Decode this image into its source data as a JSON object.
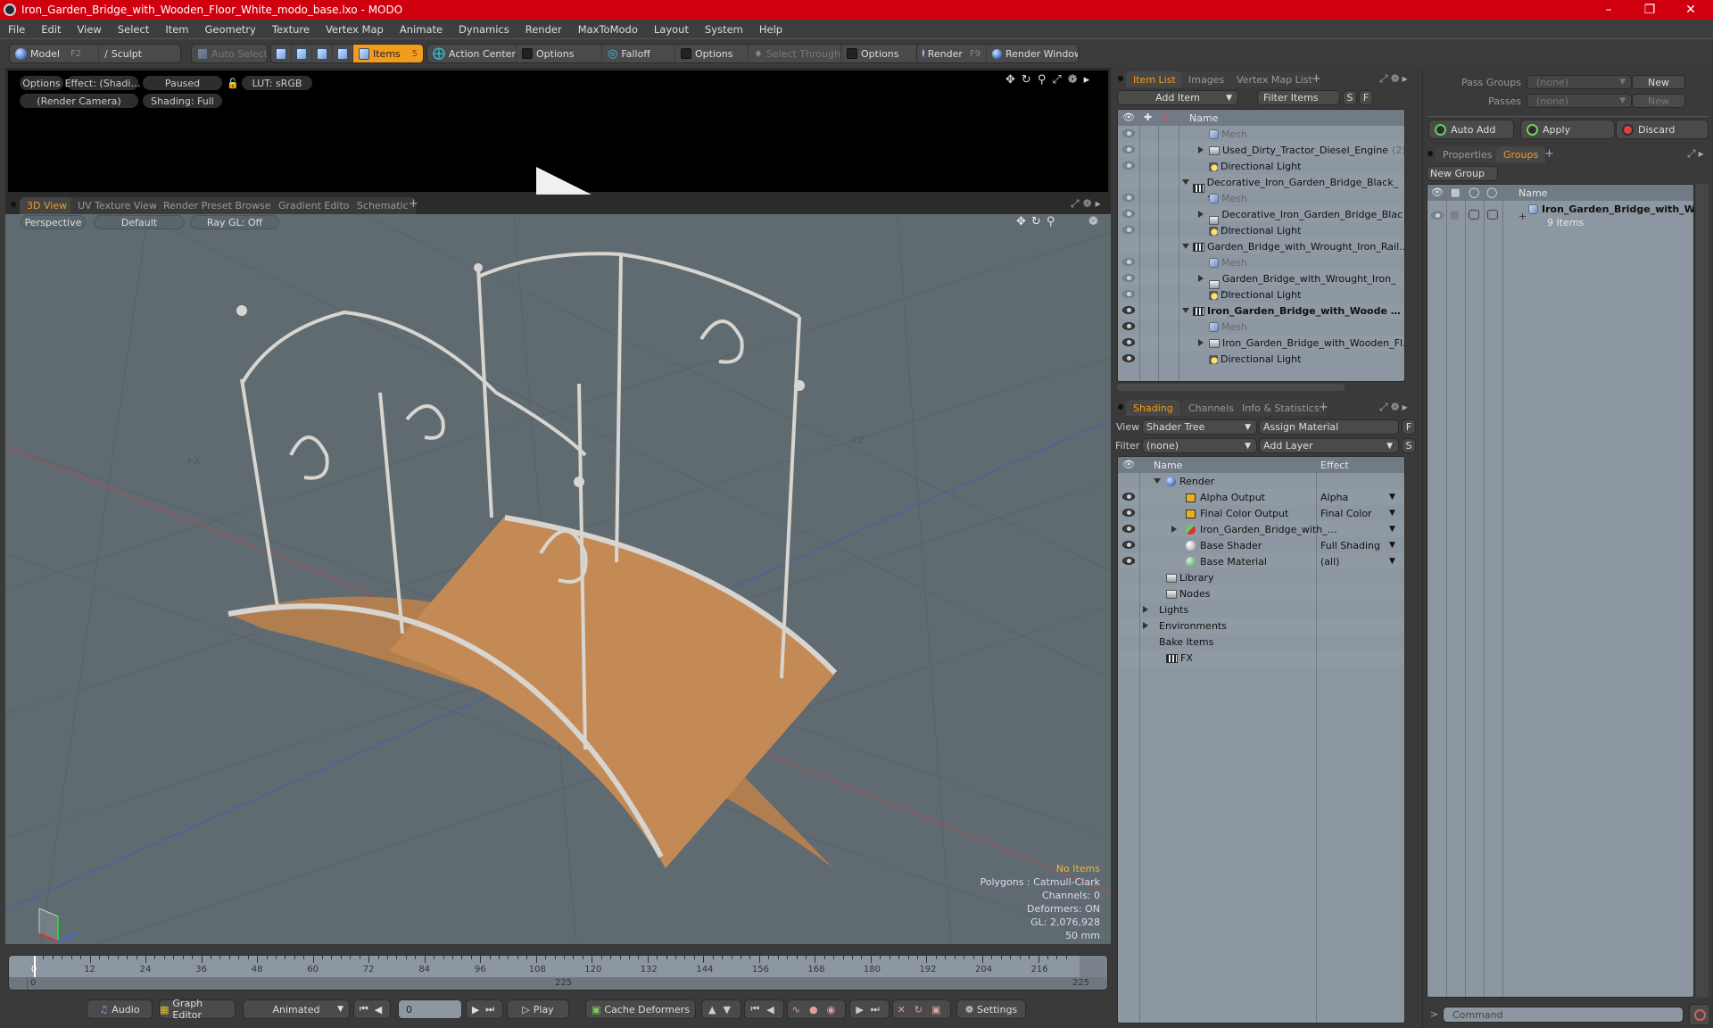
{
  "window": {
    "title": "Iron_Garden_Bridge_with_Wooden_Floor_White_modo_base.lxo - MODO",
    "controls": [
      "minimize",
      "restore",
      "close"
    ],
    "accent_color": "#d1000f"
  },
  "menu": [
    "File",
    "Edit",
    "View",
    "Select",
    "Item",
    "Geometry",
    "Texture",
    "Vertex Map",
    "Animate",
    "Dynamics",
    "Render",
    "MaxToModo",
    "Layout",
    "System",
    "Help"
  ],
  "toolbar": {
    "model_label": "Model",
    "model_key": "F2",
    "sculpt_label": "Sculpt",
    "auto_select_label": "Auto Select",
    "items_label": "Items",
    "items_count": "5",
    "action_center_label": "Action Center",
    "options_1": "Options",
    "falloff_label": "Falloff",
    "options_2": "Options",
    "select_through_label": "Select Through",
    "options_3": "Options",
    "render_label": "Render",
    "render_key": "F9",
    "render_window_label": "Render Window",
    "active_color": "#f39c1b"
  },
  "preview": {
    "options": "Options",
    "effect": "Effect: (Shadi…",
    "state": "Paused",
    "lut": "LUT: sRGB",
    "camera": "(Render Camera)",
    "shading": "Shading: Full"
  },
  "viewport_tabs": [
    "3D View",
    "UV Texture View",
    "Render Preset Browser",
    "Gradient Editor",
    "Schematic"
  ],
  "viewport": {
    "projection": "Perspective",
    "style": "Default",
    "raygl": "Ray GL: Off",
    "axis_x_label": "+X",
    "axis_z_label": "+Z",
    "stats": {
      "selection": "No Items",
      "polygons": "Polygons : Catmull-Clark",
      "channels": "Channels: 0",
      "deformers": "Deformers: ON",
      "gl": "GL: 2,076,928",
      "lens": "50 mm"
    }
  },
  "timeline": {
    "ticks": [
      "0",
      "12",
      "24",
      "36",
      "48",
      "60",
      "72",
      "84",
      "96",
      "108",
      "120",
      "132",
      "144",
      "156",
      "168",
      "180",
      "192",
      "204",
      "216"
    ],
    "range_start": "0",
    "range_end_mid": "225",
    "range_end": "225",
    "current_frame_fraction": 0.0
  },
  "bottombar": {
    "audio": "Audio",
    "graph_editor": "Graph Editor",
    "mode": "Animated",
    "frame": "0",
    "play": "Play",
    "cache_deformers": "Cache Deformers",
    "settings": "Settings"
  },
  "item_list": {
    "tabs": [
      "Item List",
      "Images",
      "Vertex Map List"
    ],
    "add_item": "Add Item",
    "filter_placeholder": "Filter Items",
    "s_btn": "S",
    "f_btn": "F",
    "name_header": "Name",
    "rows": [
      {
        "label": "Mesh",
        "type": "mesh",
        "indent": 2,
        "dim": true,
        "eye": "dim"
      },
      {
        "label": "Used_Dirty_Tractor_Diesel_Engine",
        "count": "(2)",
        "type": "folder",
        "indent": 2,
        "expand": "right",
        "eye": "dim"
      },
      {
        "label": "Directional Light",
        "type": "light",
        "indent": 2,
        "eye": "dim"
      },
      {
        "label": "Decorative_Iron_Garden_Bridge_Black_ …",
        "type": "scene",
        "indent": 1,
        "expand": "down",
        "eye": "none"
      },
      {
        "label": "Mesh",
        "type": "mesh",
        "indent": 2,
        "dim": true,
        "eye": "dim"
      },
      {
        "label": "Decorative_Iron_Garden_Bridge_Blac …",
        "type": "folder",
        "indent": 2,
        "expand": "right",
        "eye": "dim"
      },
      {
        "label": "Directional Light",
        "type": "light",
        "indent": 2,
        "eye": "dim"
      },
      {
        "label": "Garden_Bridge_with_Wrought_Iron_Rail…",
        "type": "scene",
        "indent": 1,
        "expand": "down",
        "eye": "none"
      },
      {
        "label": "Mesh",
        "type": "mesh",
        "indent": 2,
        "dim": true,
        "eye": "dim"
      },
      {
        "label": "Garden_Bridge_with_Wrought_Iron_ …",
        "type": "folder",
        "indent": 2,
        "expand": "right",
        "eye": "dim"
      },
      {
        "label": "Directional Light",
        "type": "light",
        "indent": 2,
        "eye": "dim"
      },
      {
        "label": "Iron_Garden_Bridge_with_Woode …",
        "type": "scene",
        "indent": 1,
        "expand": "down",
        "bold": true,
        "eye": "on"
      },
      {
        "label": "Mesh",
        "type": "mesh",
        "indent": 2,
        "dim": true,
        "eye": "on"
      },
      {
        "label": "Iron_Garden_Bridge_with_Wooden_Fl…",
        "type": "folder",
        "indent": 2,
        "expand": "right",
        "eye": "on"
      },
      {
        "label": "Directional Light",
        "type": "light",
        "indent": 2,
        "eye": "on"
      }
    ]
  },
  "shading": {
    "tabs": [
      "Shading",
      "Channels",
      "Info & Statistics"
    ],
    "view_label": "View",
    "view_value": "Shader Tree",
    "assign_material": "Assign Material",
    "f_btn": "F",
    "filter_label": "Filter",
    "filter_value": "(none)",
    "add_layer": "Add Layer",
    "s_btn": "S",
    "name_header": "Name",
    "effect_header": "Effect",
    "rows": [
      {
        "label": "Render",
        "icon": "render-sphere",
        "indent": 1,
        "expand": "down",
        "effect": "",
        "eye": false
      },
      {
        "label": "Alpha Output",
        "icon": "output",
        "indent": 2,
        "effect": "Alpha",
        "eye": true,
        "dropdown": true
      },
      {
        "label": "Final Color Output",
        "icon": "output",
        "indent": 2,
        "effect": "Final Color",
        "eye": true,
        "dropdown": true
      },
      {
        "label": "Iron_Garden_Bridge_with_…",
        "icon": "material-group",
        "indent": 2,
        "expand": "right",
        "effect": "",
        "eye": true,
        "dropdown": true
      },
      {
        "label": "Base Shader",
        "icon": "shader",
        "indent": 2,
        "effect": "Full Shading",
        "eye": true,
        "dropdown": true
      },
      {
        "label": "Base Material",
        "icon": "material",
        "indent": 2,
        "effect": "(all)",
        "eye": true,
        "dropdown": true
      },
      {
        "label": "Library",
        "icon": "folder",
        "indent": 1,
        "effect": "",
        "eye": false
      },
      {
        "label": "Nodes",
        "icon": "folder",
        "indent": 1,
        "effect": "",
        "eye": false
      },
      {
        "label": "Lights",
        "icon": "none",
        "indent": 0,
        "expand": "right",
        "effect": "",
        "eye": false
      },
      {
        "label": "Environments",
        "icon": "none",
        "indent": 0,
        "expand": "right",
        "effect": "",
        "eye": false
      },
      {
        "label": "Bake Items",
        "icon": "none",
        "indent": 0,
        "effect": "",
        "eye": false
      },
      {
        "label": "FX",
        "icon": "scene",
        "indent": 1,
        "effect": "",
        "eye": false
      }
    ]
  },
  "passes": {
    "pass_groups_label": "Pass Groups",
    "pass_groups_value": "(none)",
    "passes_label": "Passes",
    "passes_value": "(none)",
    "new_1": "New",
    "new_2": "New",
    "auto_add": "Auto Add",
    "apply": "Apply",
    "discard": "Discard"
  },
  "groups": {
    "tabs": [
      "Properties",
      "Groups"
    ],
    "new_group": "New Group",
    "name_header": "Name",
    "items": [
      {
        "name": "Iron_Garden_Bridge_with_W…",
        "sub": "9 Items"
      }
    ]
  },
  "command": {
    "prompt": ">",
    "placeholder": "Command"
  }
}
